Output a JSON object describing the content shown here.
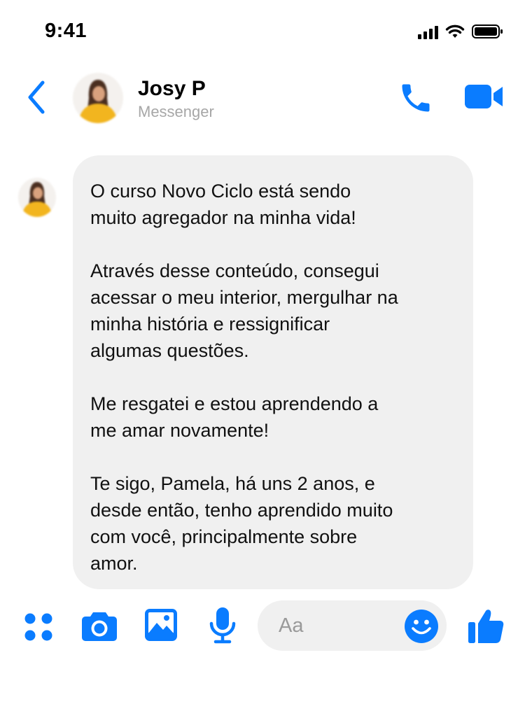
{
  "status_bar": {
    "time": "9:41"
  },
  "header": {
    "contact_name": "Josy P",
    "contact_subtitle": "Messenger",
    "icons": [
      "back-chevron",
      "avatar",
      "phone",
      "video-camera"
    ]
  },
  "conversation": {
    "messages": [
      {
        "sender": "Josy P",
        "direction": "incoming",
        "paragraphs": [
          "O curso Novo Ciclo está sendo\nmuito agregador na minha vida!",
          "Através desse conteúdo, consegui\nacessar o meu interior, mergulhar na\nminha história e ressignificar\nalgumas questões.",
          "Me resgatei e estou aprendendo a\nme amar novamente!",
          "Te sigo, Pamela, há uns 2 anos, e\ndesde então, tenho aprendido muito\ncom você, principalmente sobre\namor."
        ]
      }
    ]
  },
  "composer": {
    "placeholder": "Aa",
    "value": "",
    "icons": [
      "apps",
      "camera",
      "gallery",
      "microphone",
      "emoji",
      "like"
    ]
  },
  "colors": {
    "accent": "#0A7CFF",
    "bubble_bg": "#F0F0F0",
    "subtitle": "#A7A7A7",
    "avatar_shirt": "#F2B51F",
    "avatar_skin": "#D9A27E",
    "avatar_hair": "#4A2E1F"
  }
}
